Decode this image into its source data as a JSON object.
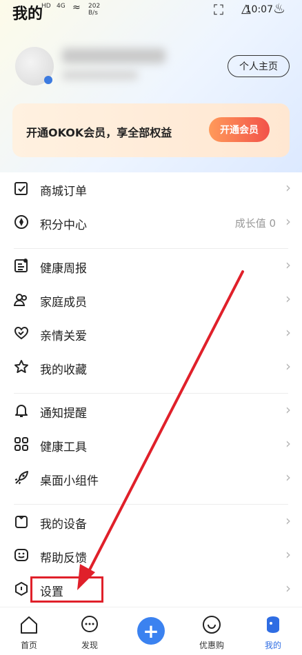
{
  "status": {
    "title": "我的",
    "left_mini": "HD",
    "net": "4G",
    "speed": "202\nB/s",
    "time": "10:07"
  },
  "profile": {
    "home_button": "个人主页"
  },
  "vip": {
    "text": "开通OKOK会员，享全部权益",
    "button": "开通会员"
  },
  "menu": [
    {
      "label": "商城订单",
      "icon": "order-icon"
    },
    {
      "label": "积分中心",
      "icon": "points-icon",
      "extra": "成长值 0"
    },
    {
      "label": "健康周报",
      "icon": "report-icon"
    },
    {
      "label": "家庭成员",
      "icon": "family-icon"
    },
    {
      "label": "亲情关爱",
      "icon": "heart-icon"
    },
    {
      "label": "我的收藏",
      "icon": "star-icon"
    },
    {
      "label": "通知提醒",
      "icon": "bell-icon"
    },
    {
      "label": "健康工具",
      "icon": "tools-icon"
    },
    {
      "label": "桌面小组件",
      "icon": "rocket-icon"
    },
    {
      "label": "我的设备",
      "icon": "device-icon"
    },
    {
      "label": "帮助反馈",
      "icon": "feedback-icon"
    },
    {
      "label": "设置",
      "icon": "settings-icon"
    }
  ],
  "tabs": [
    {
      "label": "首页"
    },
    {
      "label": "发现"
    },
    {
      "label": "优惠购"
    },
    {
      "label": "我的"
    }
  ],
  "colors": {
    "accent": "#3b82f0",
    "vip_button": "#f2524a",
    "annotation": "#e0202a"
  }
}
